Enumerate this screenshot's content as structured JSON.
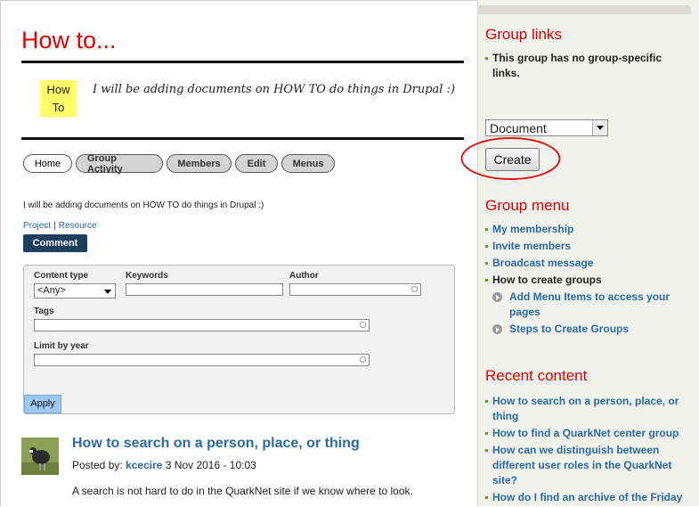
{
  "page": {
    "title": "How to...",
    "logo_line1": "How",
    "logo_line2": "To",
    "intro_italic": "I will be adding documents on HOW TO do things in Drupal :)",
    "tabs": [
      {
        "label": "Home",
        "active": true
      },
      {
        "label": "Group Activity"
      },
      {
        "label": "Members"
      },
      {
        "label": "Edit"
      },
      {
        "label": "Menus"
      }
    ],
    "description": "I will be adding documents on HOW TO do things in Drupal :)",
    "link_project": "Project",
    "link_resource": "Resource",
    "comment_label": "Comment"
  },
  "filters": {
    "content_type_label": "Content type",
    "content_type_value": "<Any>",
    "keywords_label": "Keywords",
    "author_label": "Author",
    "tags_label": "Tags",
    "limit_label": "Limit by year",
    "apply_label": "Apply"
  },
  "post": {
    "title": "How to search on a person, place, or thing",
    "posted_by": "Posted by:",
    "author": "kcecire",
    "date": "3 Nov 2016 - 10:03",
    "body": "A search is not hard to do in the QuarkNet site if we know where to look."
  },
  "sidebar": {
    "group_links_title": "Group links",
    "group_links_text": "This group has no group-specific links.",
    "doc_select_value": "Document",
    "create_label": "Create",
    "group_menu_title": "Group menu",
    "group_menu": [
      "My membership",
      "Invite members",
      "Broadcast message",
      "How to create groups"
    ],
    "group_submenu": [
      "Add Menu Items to access your pages",
      "Steps to Create Groups"
    ],
    "recent_title": "Recent content",
    "recent": [
      "How to search on a person, place, or thing",
      "How to find a QuarkNet center group",
      "How can we distinguish between different user roles in the QuarkNet site?",
      "How do I find an archive of the Friday"
    ]
  },
  "colors": {
    "title_red": "#e10000",
    "link_blue": "#2a6aa5",
    "comment_bg": "#1d3f5e",
    "apply_bg": "#9cc9f2",
    "highlight_yellow": "#ffff66",
    "annotation_red": "#d81c1c"
  }
}
